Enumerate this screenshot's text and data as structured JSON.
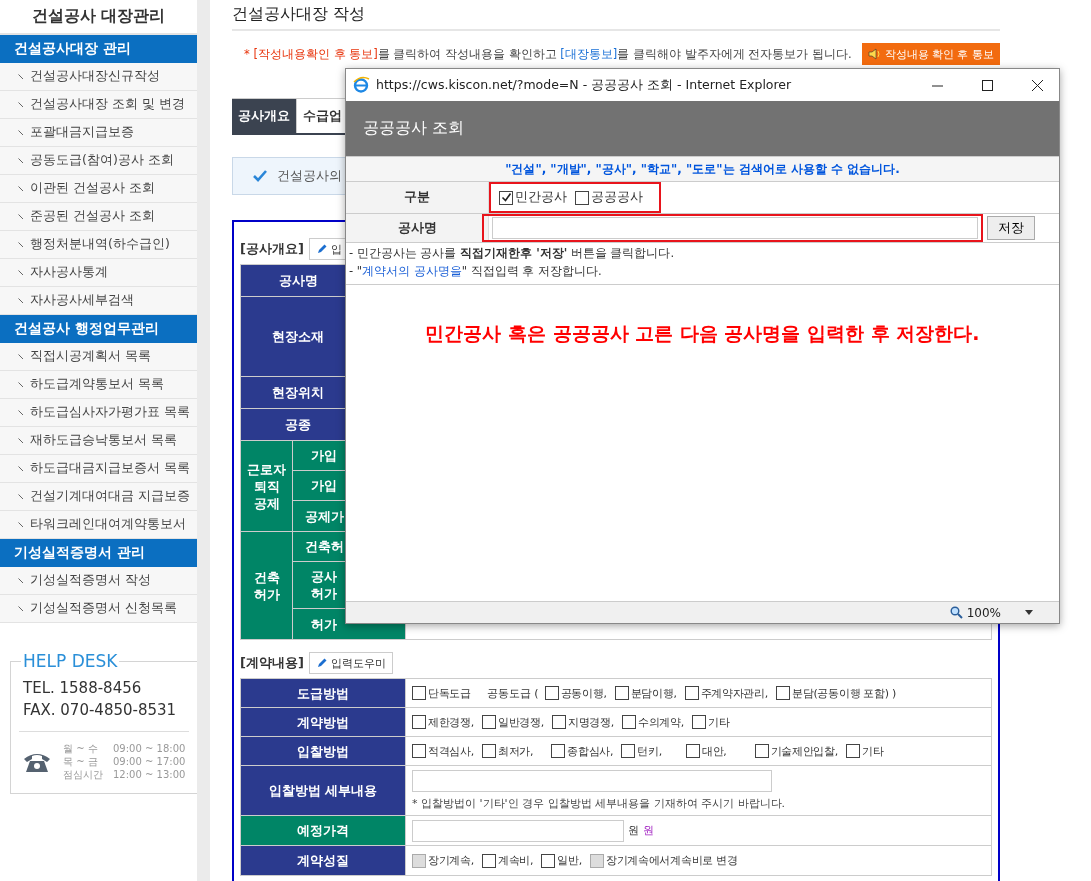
{
  "sidebar": {
    "title": "건설공사 대장관리",
    "sections": [
      {
        "title": "건설공사대장 관리",
        "items": [
          {
            "label": "건설공사대장신규작성"
          },
          {
            "label": "건설공사대장 조회 및 변경"
          },
          {
            "label": "포괄대금지급보증"
          },
          {
            "label": "공동도급(참여)공사 조회"
          },
          {
            "label": "이관된 건설공사 조회"
          },
          {
            "label": "준공된 건설공사 조회"
          },
          {
            "label": "행정처분내역(하수급인)"
          },
          {
            "label": "자사공사통계"
          },
          {
            "label": "자사공사세부검색"
          }
        ]
      },
      {
        "title": "건설공사 행정업무관리",
        "items": [
          {
            "label": "직접시공계획서 목록"
          },
          {
            "label": "하도급계약통보서 목록"
          },
          {
            "label": "하도급심사자가평가표 목록"
          },
          {
            "label": "재하도급승낙통보서 목록"
          },
          {
            "label": "하도급대금지급보증서 목록"
          },
          {
            "label": "건설기계대여대금 지급보증"
          },
          {
            "label": "타워크레인대여계약통보서"
          }
        ]
      },
      {
        "title": "기성실적증명서 관리",
        "items": [
          {
            "label": "기성실적증명서 작성"
          },
          {
            "label": "기성실적증명서 신청목록"
          }
        ]
      }
    ]
  },
  "help_desk": {
    "title": "HELP DESK",
    "tel": "TEL. 1588-8456",
    "fax": "FAX. 070-4850-8531",
    "hours": [
      {
        "days": "월 ~ 수",
        "time": "09:00 ~ 18:00"
      },
      {
        "days": "목 ~ 금",
        "time": "09:00 ~ 17:00"
      },
      {
        "days": "점심시간",
        "time": "12:00 ~ 13:00"
      }
    ]
  },
  "page": {
    "title": "건설공사대장 작성",
    "notice": [
      {
        "kind": "alert",
        "text": "* "
      },
      {
        "kind": "alert",
        "text": "[작성내용확인 후 통보]"
      },
      {
        "kind": "plain",
        "text": "를 클릭하여 작성내용을 확인하고 "
      },
      {
        "kind": "link",
        "text": "[대장통보]"
      },
      {
        "kind": "plain",
        "text": "를 클릭해야 발주자에게 전자통보가 됩니다."
      }
    ],
    "notice_button": "작성내용 확인 후 통보",
    "tabs": [
      {
        "label": "공사개요",
        "selected": true
      },
      {
        "label": "수급업",
        "selected": false
      }
    ],
    "info": "건설공사의"
  },
  "overview": {
    "title": "[공사개요]",
    "helper_button": "입",
    "rows": [
      {
        "kind": "single",
        "label": "공사명",
        "color": "#2b3a8e"
      },
      {
        "kind": "address",
        "label": "현장소재",
        "color": "#2b3a8e"
      },
      {
        "kind": "single",
        "label": "현장위치",
        "color": "#2b3a8e"
      },
      {
        "kind": "single",
        "label": "공종",
        "color": "#2b3a8e"
      },
      {
        "kind": "group",
        "label": "근로자\n퇴직\n공제",
        "color": "#008566",
        "children": [
          {
            "label": "가입"
          },
          {
            "label": "가입"
          },
          {
            "label": "공제가"
          }
        ]
      },
      {
        "kind": "group",
        "label": "건축\n허가",
        "color": "#008566",
        "children": [
          {
            "label": "건축허"
          },
          {
            "label": "공사\n허가"
          },
          {
            "label": "허가"
          }
        ]
      }
    ]
  },
  "contract": {
    "title": "[계약내용]",
    "helper_button": "입력도우미",
    "rows": [
      {
        "kind": "options",
        "label": "도급방법",
        "color": "#2b3a8e",
        "items": [
          {
            "kind": "checkbox",
            "label": "단독도급",
            "checked": false,
            "disabled": false
          },
          {
            "kind": "text",
            "label": "공동도급 ("
          },
          {
            "kind": "checkbox",
            "label": "공동이행,",
            "checked": false,
            "disabled": false
          },
          {
            "kind": "checkbox",
            "label": "분담이행,",
            "checked": false,
            "disabled": false
          },
          {
            "kind": "checkbox",
            "label": "주계약자관리,",
            "checked": false,
            "disabled": false
          },
          {
            "kind": "checkbox",
            "label": "분담(공동이행 포함) )",
            "checked": false,
            "disabled": false
          }
        ]
      },
      {
        "kind": "options",
        "label": "계약방법",
        "color": "#2b3a8e",
        "items": [
          {
            "kind": "checkbox",
            "label": "제한경쟁,",
            "checked": false,
            "disabled": false
          },
          {
            "kind": "checkbox",
            "label": "일반경쟁,",
            "checked": false,
            "disabled": false
          },
          {
            "kind": "checkbox",
            "label": "지명경쟁,",
            "checked": false,
            "disabled": false
          },
          {
            "kind": "checkbox",
            "label": "수의계약,",
            "checked": false,
            "disabled": false
          },
          {
            "kind": "checkbox",
            "label": "기타",
            "checked": false,
            "disabled": false
          }
        ]
      },
      {
        "kind": "options",
        "label": "입찰방법",
        "color": "#2b3a8e",
        "items": [
          {
            "kind": "checkbox",
            "label": "적격심사,",
            "checked": false,
            "disabled": false
          },
          {
            "kind": "checkbox",
            "label": "최저가,",
            "checked": false,
            "disabled": false
          },
          {
            "kind": "checkbox",
            "label": "종합심사,",
            "checked": false,
            "disabled": false
          },
          {
            "kind": "checkbox",
            "label": "턴키,",
            "checked": false,
            "disabled": false
          },
          {
            "kind": "checkbox",
            "label": "대안,",
            "checked": false,
            "disabled": false
          },
          {
            "kind": "checkbox",
            "label": "기술제안입찰,",
            "checked": false,
            "disabled": false
          },
          {
            "kind": "checkbox",
            "label": "기타",
            "checked": false,
            "disabled": false
          }
        ]
      },
      {
        "kind": "detail",
        "label": "입찰방법 세부내용",
        "color": "#2b3a8e",
        "note": "* 입찰방법이 '기타'인 경우 입찰방법 세부내용을 기재하여 주시기 바랍니다."
      },
      {
        "kind": "price",
        "label": "예정가격",
        "color": "#008566",
        "unit": "원",
        "unit_note": "원"
      },
      {
        "kind": "options",
        "label": "계약성질",
        "color": "#2b3a8e",
        "items": [
          {
            "kind": "checkbox",
            "label": "장기계속,",
            "checked": false,
            "disabled": true
          },
          {
            "kind": "checkbox",
            "label": "계속비,",
            "checked": false,
            "disabled": false
          },
          {
            "kind": "checkbox",
            "label": "일반,",
            "checked": false,
            "disabled": false
          },
          {
            "kind": "checkbox",
            "label": "장기계속에서계속비로 변경",
            "checked": false,
            "disabled": true
          }
        ]
      }
    ]
  },
  "popup": {
    "title": "https://cws.kiscon.net/?mode=N - 공공공사 조회 - Internet Explorer",
    "header": "공공공사 조회",
    "warning": "\"건설\", \"개발\", \"공사\", \"학교\", \"도로\"는 검색어로 사용할 수 없습니다.",
    "type_label": "구분",
    "types": [
      {
        "label": "민간공사",
        "checked": true
      },
      {
        "label": "공공공사",
        "checked": false
      }
    ],
    "name_label": "공사명",
    "save_button": "저장",
    "notes": [
      {
        "kind": "rich",
        "text": "- 민간공사는 공사를 **직접기재한후 '저장'** 버튼을 클릭합니다."
      },
      {
        "kind": "highlight",
        "before": "- \"",
        "highlight": "계약서의 공사명을",
        "after": "\" 직접입력 후 저장합니다."
      }
    ],
    "instruction": "민간공사 혹은 공공공사 고른 다음 공사명을 입력한 후 저장한다.",
    "zoom": "100%"
  }
}
